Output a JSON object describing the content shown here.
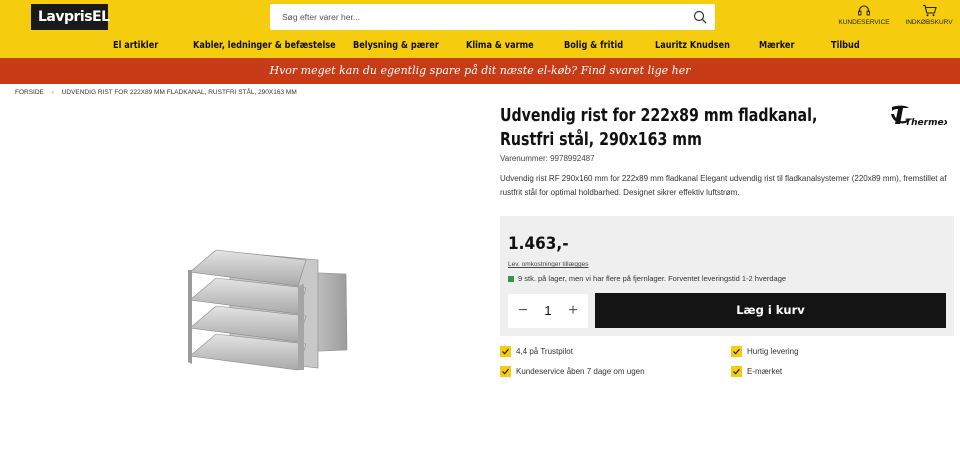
{
  "header": {
    "logo_text": "LavprisEL",
    "search_placeholder": "Søg efter varer her...",
    "customer_service": "KUNDESERVICE",
    "cart": "INDKØBSKURV"
  },
  "nav": {
    "items": [
      "El artikler",
      "Kabler, ledninger & befæstelse",
      "Belysning & pærer",
      "Klima & varme",
      "Bolig & fritid",
      "Lauritz Knudsen",
      "Mærker",
      "Tilbud"
    ]
  },
  "promo": {
    "text": "Hvor meget kan du egentlig spare på dit næste el-køb? Find svaret lige her"
  },
  "breadcrumb": {
    "home": "FORSIDE",
    "current": "UDVENDIG RIST FOR 222X89 MM FLADKANAL, RUSTFRI STÅL, 290X163 MM"
  },
  "product": {
    "title": "Udvendig rist for 222x89 mm fladkanal, Rustfri stål, 290x163 mm",
    "brand": "Thermex",
    "sku": "Varenummer: 9978992487",
    "description": "Udvendig rist RF 290x160 mm for 222x89 mm fladkanal Elegant udvendig rist til fladkanalsystemer (220x89 mm), fremstillet af rustfrit stål for optimal holdbarhed. Designet sikrer effektiv luftstrøm.",
    "price": "1.463,-",
    "shipping_note": "Lev. omkostninger tillægges",
    "stock_text": "9 stk. på lager, men vi har flere på fjernlager.  Forventet leveringstid 1-2 hverdage",
    "stock_color": "#2e9c3d",
    "quantity": "1",
    "add_to_cart": "Læg i kurv"
  },
  "usps": {
    "trustpilot": "4,4 på Trustpilot",
    "fast_delivery": "Hurtig levering",
    "service_hours": "Kundeservice åben 7 dage om ugen",
    "e_mark": "E-mærket"
  },
  "colors": {
    "brand_yellow": "#f6cc0f",
    "promo_red": "#c73c17",
    "button_black": "#141414"
  }
}
